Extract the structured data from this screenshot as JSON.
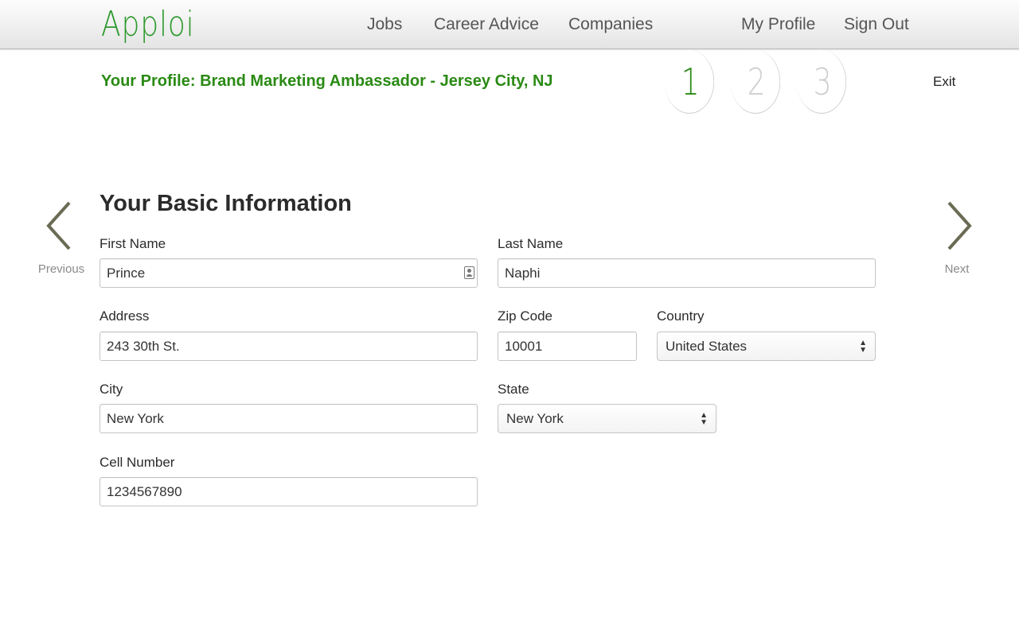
{
  "brand": {
    "logo_text": "Apploi",
    "accent": "#2a8a14"
  },
  "nav": {
    "jobs": "Jobs",
    "career_advice": "Career Advice",
    "companies": "Companies",
    "my_profile": "My Profile",
    "sign_out": "Sign Out"
  },
  "profile": {
    "title": "Your Profile: Brand Marketing Ambassador - Jersey City, NJ",
    "steps": [
      "1",
      "2",
      "3"
    ],
    "active_step": 1,
    "exit": "Exit"
  },
  "pager": {
    "previous": "Previous",
    "next": "Next"
  },
  "form": {
    "section_title": "Your Basic Information",
    "first_name": {
      "label": "First Name",
      "value": "Prince"
    },
    "last_name": {
      "label": "Last Name",
      "value": "Naphi"
    },
    "address": {
      "label": "Address",
      "value": "243 30th St."
    },
    "zip": {
      "label": "Zip Code",
      "value": "10001"
    },
    "country": {
      "label": "Country",
      "value": "United States"
    },
    "city": {
      "label": "City",
      "value": "New York"
    },
    "state": {
      "label": "State",
      "value": "New York"
    },
    "cell": {
      "label": "Cell Number",
      "value": "1234567890"
    }
  },
  "icons": {
    "previous": "chevron-left-icon",
    "next": "chevron-right-icon",
    "contact_card": "contact-card-icon",
    "select_arrows": "updown-arrows-icon"
  }
}
